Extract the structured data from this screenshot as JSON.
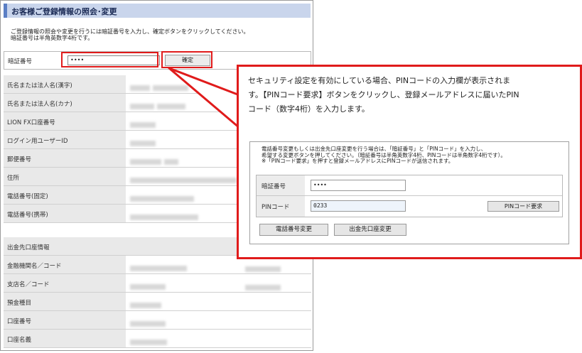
{
  "page": {
    "title": "お客様ご登録情報の照会･変更",
    "intro_line1": "ご登録情報の照会や変更を行うには暗証番号を入力し、確定ボタンをクリックしてください。",
    "intro_line2": "暗証番号は半角英数字4桁です。"
  },
  "auth": {
    "label": "暗証番号",
    "value": "••••",
    "confirm_label": "確定"
  },
  "fields": [
    {
      "label": "氏名または法人名(漢字)"
    },
    {
      "label": "氏名または法人名(カナ)"
    },
    {
      "label": "LION FX口座番号"
    },
    {
      "label": "ログイン用ユーザーID"
    },
    {
      "label": "郵便番号"
    },
    {
      "label": "住所"
    },
    {
      "label": "電話番号(固定)"
    },
    {
      "label": "電話番号(携帯)"
    }
  ],
  "bank_section": {
    "heading": "出金先口座情報",
    "fields": [
      {
        "label": "金融機関名／コード"
      },
      {
        "label": "支店名／コード"
      },
      {
        "label": "預金種目"
      },
      {
        "label": "口座番号"
      },
      {
        "label": "口座名義"
      }
    ]
  },
  "callout": {
    "text_line1": "セキュリティ設定を有効にしている場合、PINコードの入力欄が表示されま",
    "text_line2": "す。【PINコード要求】ボタンをクリックし、登録メールアドレスに届いたPIN",
    "text_line3": "コード（数字4桁）を入力します。",
    "notice_line1": "電話番号変更もしくは出金先口座変更を行う場合は、「暗証番号」と「PINコード」を入力し、",
    "notice_line2": "希望する変更ボタンを押してください。（暗証番号は半角英数字4桁、PINコードは半角数字4桁です）。",
    "notice_line3": "※「PINコード要求」を押すと登録メールアドレスにPINコードが送信されます。",
    "pin_auth_label": "暗証番号",
    "pin_auth_value": "••••",
    "pin_label": "PINコード",
    "pin_value": "0233",
    "pin_request_label": "PINコード要求",
    "phone_change_label": "電話番号変更",
    "bank_change_label": "出金先口座変更"
  },
  "colors": {
    "highlight": "#e01b1b",
    "title_bg": "#c9d5ec",
    "title_accent": "#5b7fc4"
  }
}
